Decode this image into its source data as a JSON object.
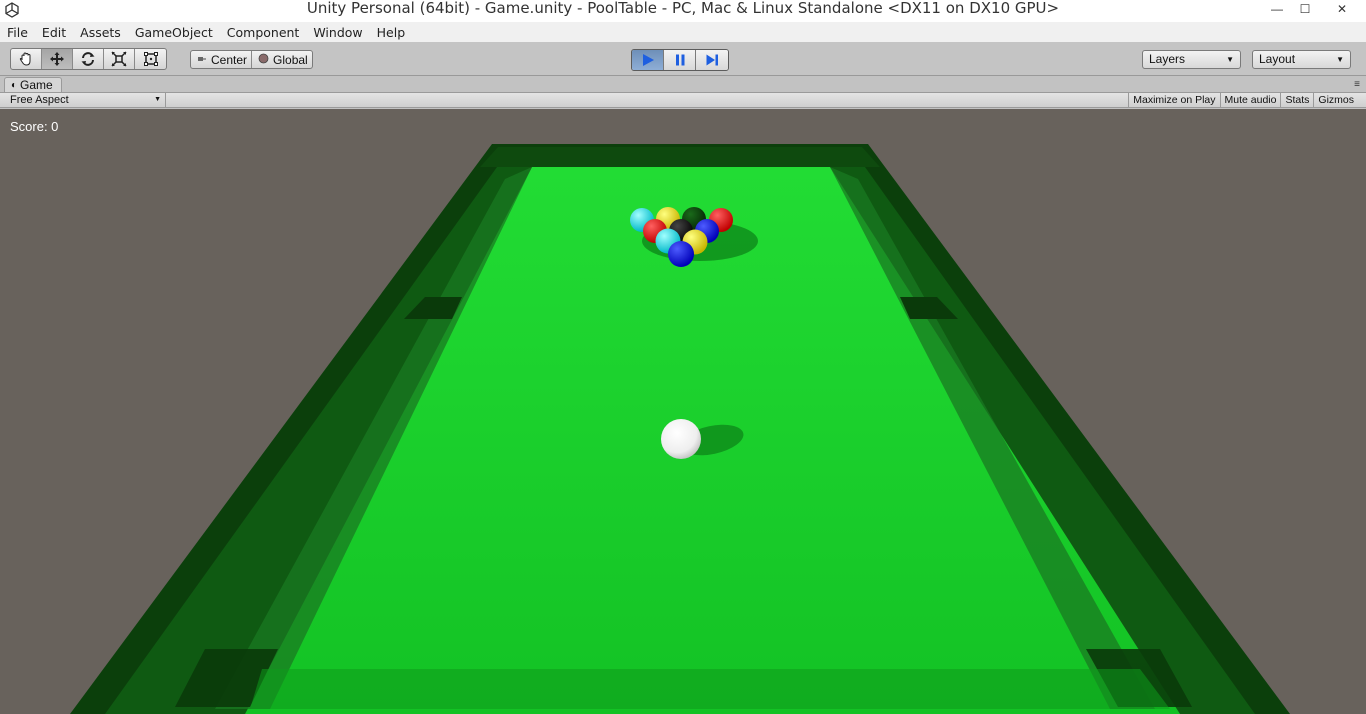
{
  "window": {
    "title": "Unity Personal (64bit) - Game.unity - PoolTable - PC, Mac & Linux Standalone <DX11 on DX10 GPU>",
    "minimize_glyph": "—",
    "maximize_glyph": "☐",
    "close_glyph": "✕"
  },
  "menu": {
    "items": [
      "File",
      "Edit",
      "Assets",
      "GameObject",
      "Component",
      "Window",
      "Help"
    ]
  },
  "toolbar": {
    "tools": [
      "hand-tool-icon",
      "move-tool-icon",
      "rotate-tool-icon",
      "scale-tool-icon",
      "rect-tool-icon"
    ],
    "pivot_mode_label": "Center",
    "pivot_rotation_label": "Global",
    "layers_label": "Layers",
    "layout_label": "Layout"
  },
  "game_panel": {
    "tab_label": "Game",
    "aspect_label": "Free Aspect",
    "maximize_on_play": "Maximize on Play",
    "mute_audio": "Mute audio",
    "stats": "Stats",
    "gizmos": "Gizmos"
  },
  "game_view": {
    "score_text": "Score: 0",
    "colors": {
      "background": "#68625c",
      "felt": "#1ed22e",
      "rail": "#0b3f0b",
      "cue_ball": "#ffffff"
    }
  }
}
